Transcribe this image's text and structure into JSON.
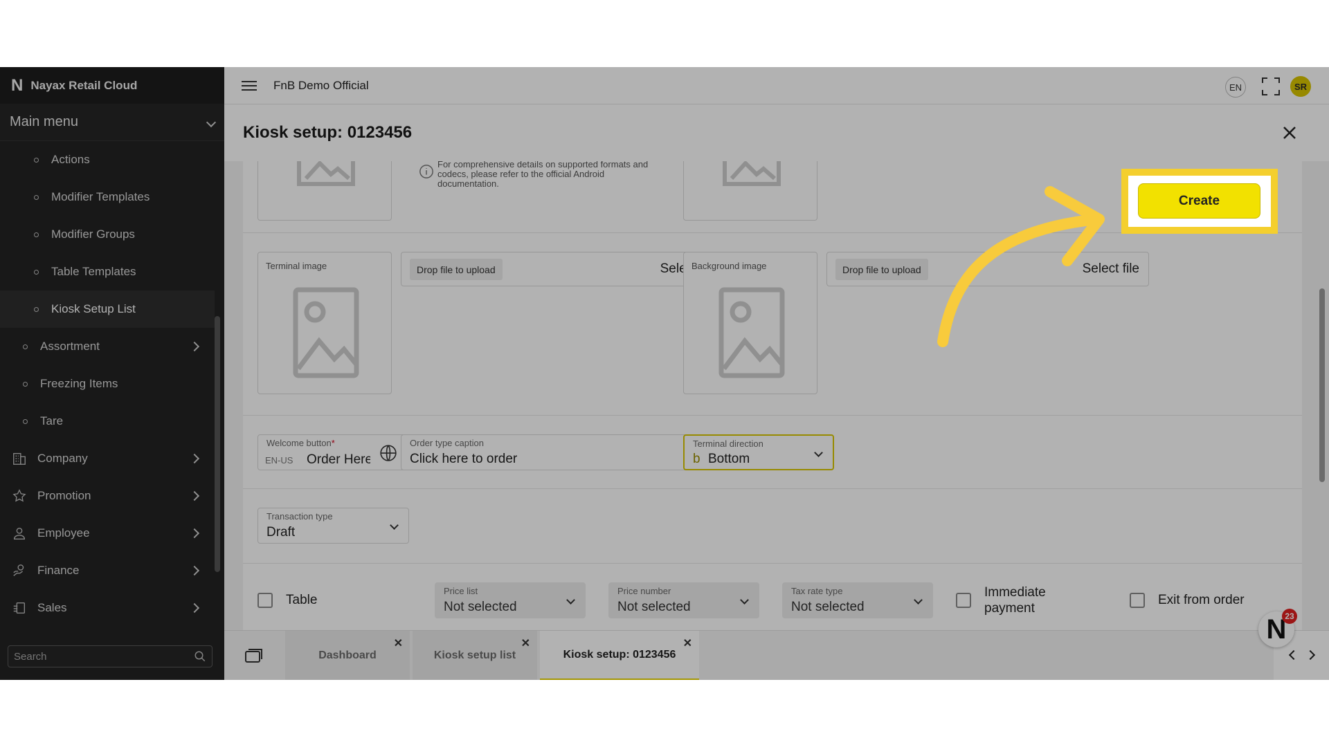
{
  "app": {
    "name": "Nayax Retail Cloud",
    "logo": "N"
  },
  "topbar": {
    "org": "FnB Demo Official",
    "lang": "EN",
    "avatar": "SR"
  },
  "sidebar": {
    "main_menu": "Main menu",
    "items": [
      {
        "label": "Actions"
      },
      {
        "label": "Modifier Templates"
      },
      {
        "label": "Modifier Groups"
      },
      {
        "label": "Table Templates"
      },
      {
        "label": "Kiosk Setup List"
      },
      {
        "label": "Assortment"
      },
      {
        "label": "Freezing Items"
      },
      {
        "label": "Tare"
      },
      {
        "label": "Company",
        "icon": "building-icon"
      },
      {
        "label": "Promotion",
        "icon": "star-icon"
      },
      {
        "label": "Employee",
        "icon": "user-icon"
      },
      {
        "label": "Finance",
        "icon": "finance-icon"
      },
      {
        "label": "Sales",
        "icon": "sales-icon"
      }
    ],
    "search_placeholder": "Search"
  },
  "page": {
    "title": "Kiosk setup: 0123456",
    "create_label": "Create",
    "info_text": "For comprehensive details on supported formats and codecs, please refer to the official Android documentation.",
    "terminal_image": {
      "label": "Terminal image",
      "drop": "Drop file to upload",
      "select": "Select file"
    },
    "background_image": {
      "label": "Background image",
      "drop": "Drop file to upload",
      "select": "Select file"
    },
    "welcome_button": {
      "label": "Welcome button",
      "required": "*",
      "lang": "EN-US",
      "value": "Order Here"
    },
    "order_type_caption": {
      "label": "Order type caption",
      "value": "Click here to order"
    },
    "terminal_direction": {
      "label": "Terminal direction",
      "prefix": "b",
      "value": "Bottom"
    },
    "transaction_type": {
      "label": "Transaction type",
      "value": "Draft"
    },
    "table_label": "Table",
    "price_list": {
      "label": "Price list",
      "value": "Not selected"
    },
    "price_number": {
      "label": "Price number",
      "value": "Not selected"
    },
    "tax_rate_type": {
      "label": "Tax rate type",
      "value": "Not selected"
    },
    "immediate_payment": "Immediate payment",
    "exit_from_order": "Exit from order"
  },
  "tabs": [
    {
      "label": "Dashboard"
    },
    {
      "label": "Kiosk setup list"
    },
    {
      "label": "Kiosk setup: 0123456",
      "active": true
    }
  ],
  "notification_count": "23",
  "colors": {
    "accent": "#f2e100",
    "highlight": "#f4cf2e",
    "sidebar": "#232323"
  }
}
